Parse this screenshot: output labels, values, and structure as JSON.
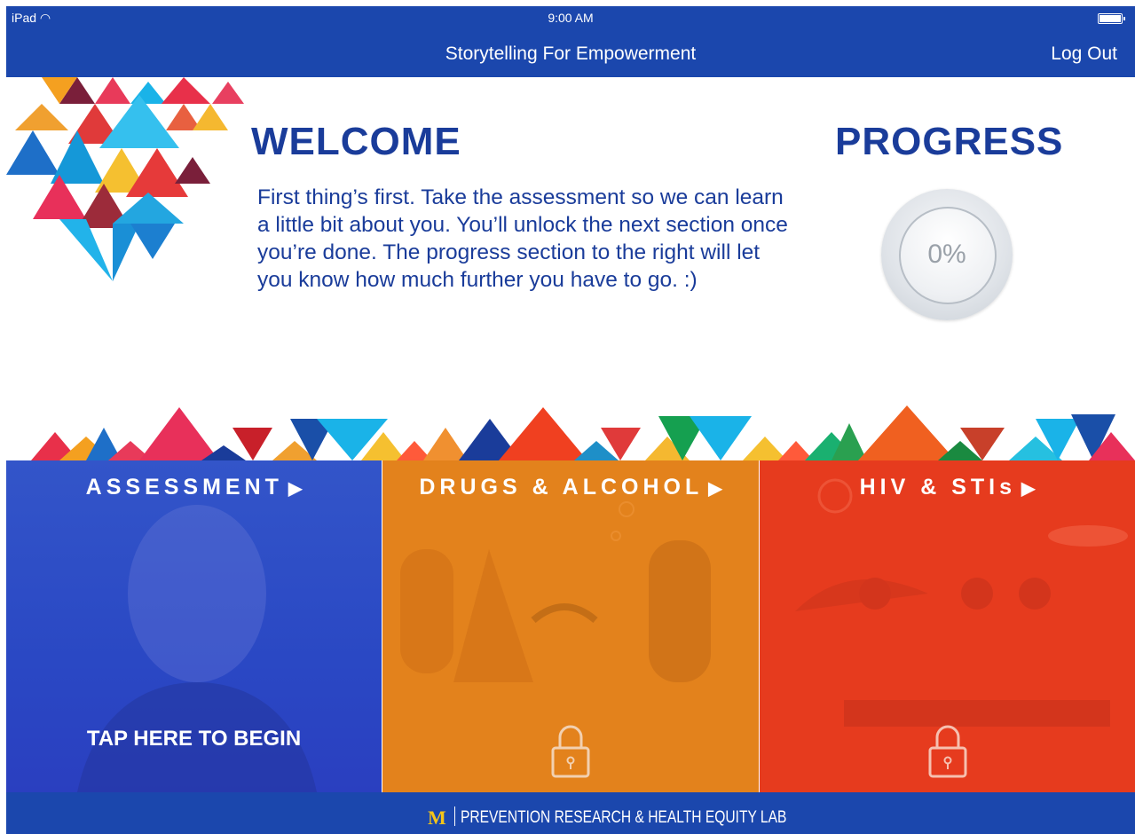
{
  "status_bar": {
    "device": "iPad",
    "time": "9:00 AM"
  },
  "nav": {
    "title": "Storytelling For Empowerment",
    "logout_label": "Log Out"
  },
  "welcome": {
    "title": "WELCOME",
    "body": "First thing’s first. Take the assessment so we can learn a little bit about you. You’ll unlock the next section once you’re done. The progress section to the right will let you know how much further you have to go. :)"
  },
  "progress": {
    "title": "PROGRESS",
    "value": "0%",
    "fraction": 0
  },
  "modules": [
    {
      "label": "ASSESSMENT",
      "arrow": "▶",
      "cta": "TAP HERE TO BEGIN",
      "locked": false,
      "color": "#2a48c4"
    },
    {
      "label": "DRUGS & ALCOHOL",
      "arrow": "▶",
      "locked": true,
      "color": "#e3821c"
    },
    {
      "label": "HIV & STIs",
      "arrow": "▶",
      "locked": true,
      "color": "#e63b1e"
    }
  ],
  "footer": {
    "logo_mark": "M",
    "text": "PREVENTION RESEARCH & HEALTH EQUITY LAB"
  },
  "colors": {
    "brand_blue": "#1b47ad",
    "heading_blue": "#1a3c9a"
  }
}
